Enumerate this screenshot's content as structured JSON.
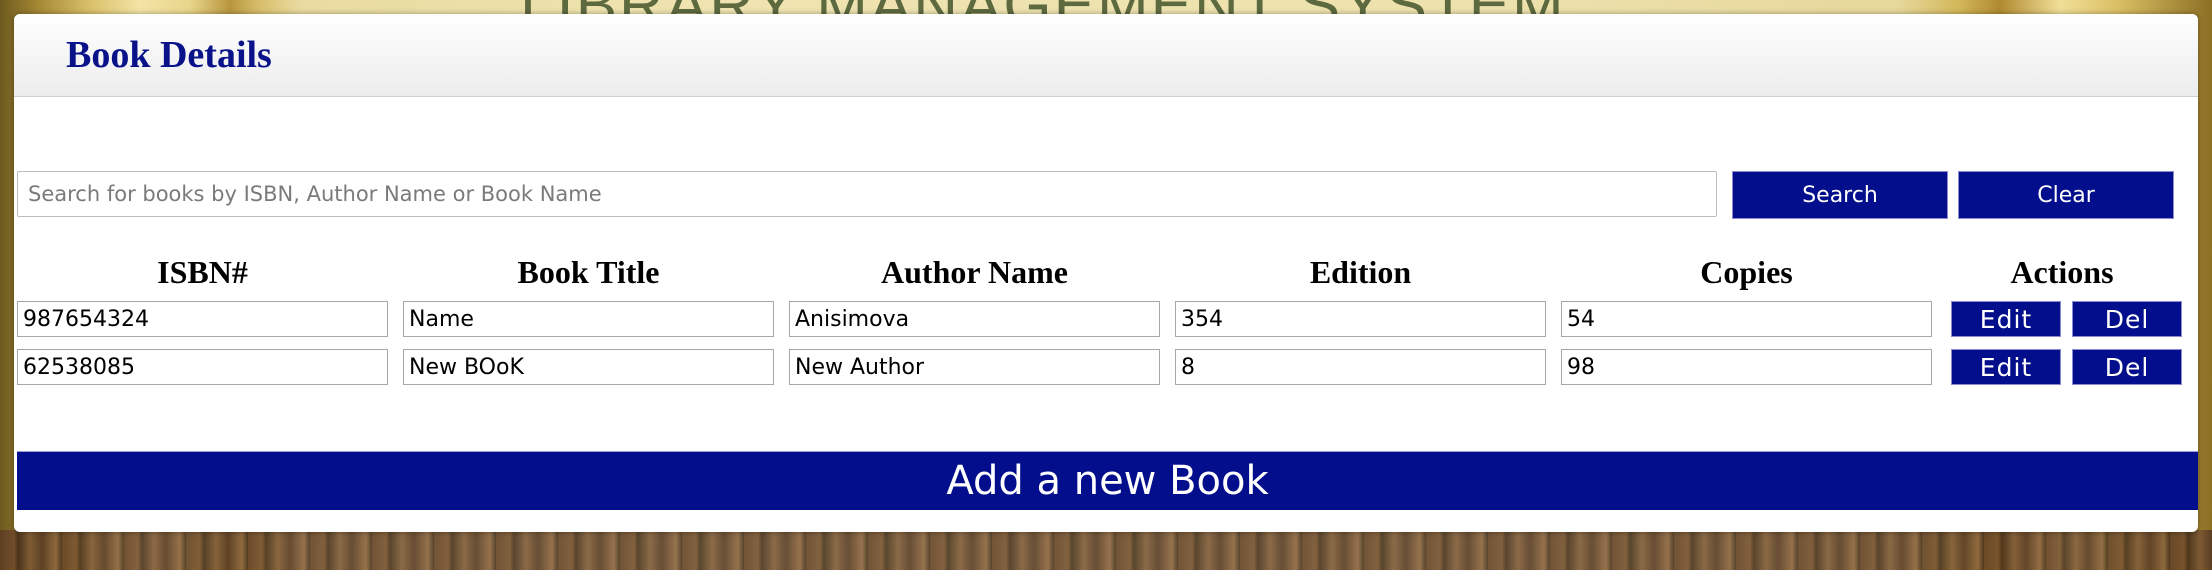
{
  "background": {
    "title": "LIBRARY MANAGEMENT SYSTEM"
  },
  "panel": {
    "title": "Book Details"
  },
  "search": {
    "placeholder": "Search for books by ISBN, Author Name or Book Name",
    "value": "",
    "search_label": "Search",
    "clear_label": "Clear"
  },
  "table": {
    "headers": [
      "ISBN#",
      "Book Title",
      "Author Name",
      "Edition",
      "Copies",
      "Actions"
    ],
    "rows": [
      {
        "isbn": "987654324",
        "title": "Name",
        "author": "Anisimova",
        "edition": "354",
        "copies": "54",
        "edit_label": "Edit",
        "del_label": "Del"
      },
      {
        "isbn": "62538085",
        "title": "New BOoK",
        "author": "New Author",
        "edition": "8",
        "copies": "98",
        "edit_label": "Edit",
        "del_label": "Del"
      }
    ]
  },
  "add_book_label": "Add a new Book",
  "colors": {
    "accent": "#030e8c",
    "title": "#0a128a"
  }
}
